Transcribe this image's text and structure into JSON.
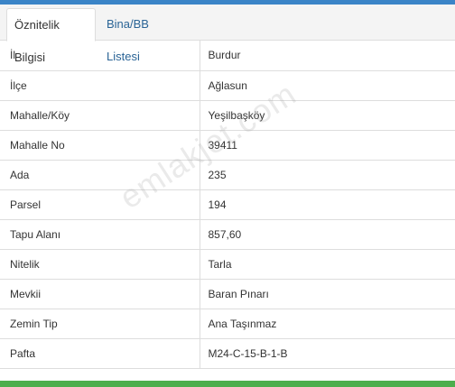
{
  "tabs": [
    {
      "label": "Öznitelik Bilgisi",
      "active": true
    },
    {
      "label": "Bina/BB Listesi",
      "active": false
    }
  ],
  "rows": [
    {
      "label": "İl",
      "value": "Burdur"
    },
    {
      "label": "İlçe",
      "value": "Ağlasun"
    },
    {
      "label": "Mahalle/Köy",
      "value": "Yeşilbaşköy"
    },
    {
      "label": "Mahalle No",
      "value": "39411"
    },
    {
      "label": "Ada",
      "value": "235"
    },
    {
      "label": "Parsel",
      "value": "194"
    },
    {
      "label": "Tapu Alanı",
      "value": "857,60"
    },
    {
      "label": "Nitelik",
      "value": "Tarla"
    },
    {
      "label": "Mevkii",
      "value": "Baran Pınarı"
    },
    {
      "label": "Zemin Tip",
      "value": "Ana Taşınmaz"
    },
    {
      "label": "Pafta",
      "value": "M24-C-15-B-1-B"
    }
  ],
  "watermark": "emlakjet.com",
  "colors": {
    "accent_top": "#3a84c7",
    "accent_bottom": "#4cae4c",
    "link": "#2a6496"
  }
}
